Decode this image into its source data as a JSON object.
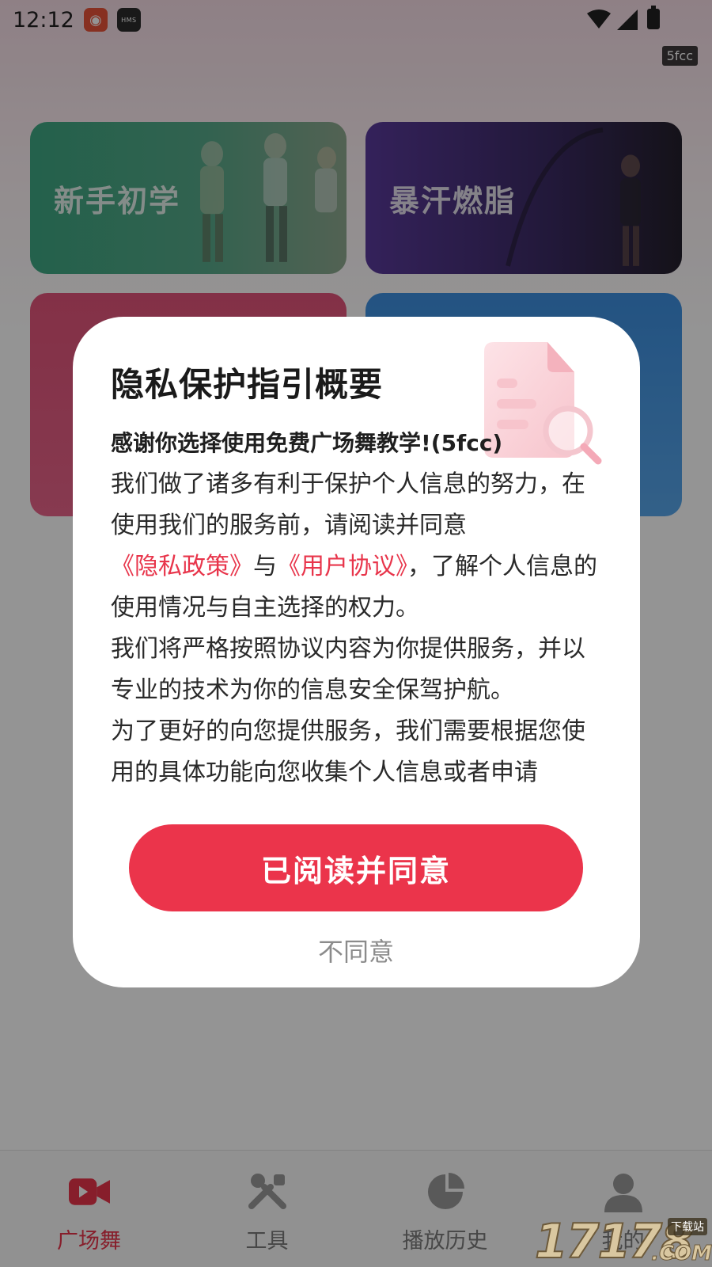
{
  "status_bar": {
    "time": "12:12",
    "app_icons": [
      "weibo-icon",
      "hms-icon"
    ],
    "hms_label": "HMS",
    "system_icons": [
      "wifi-icon",
      "signal-icon",
      "battery-icon"
    ]
  },
  "corner_tag": "5fcc",
  "category_cards": [
    {
      "label": "新手初学",
      "color": "#3ea883"
    },
    {
      "label": "暴汗燃脂",
      "color": "#5a3a9c"
    },
    {
      "label": "",
      "color": "#e2547a"
    },
    {
      "label": "",
      "color": "#3d8fe0"
    }
  ],
  "privacy_dialog": {
    "title": "隐私保护指引概要",
    "illustration": "document-search-icon",
    "lead": "感谢你选择使用免费广场舞教学!(5fcc)",
    "paragraph_1_before": "我们做了诸多有利于保护个人信息的努力，在使用我们的服务前，请阅读并同意",
    "privacy_policy_link": "《隐私政策》",
    "connector": "与",
    "user_agreement_link": "《用户协议》",
    "paragraph_1_after": "，了解个人信息的使用情况与自主选择的权力。",
    "paragraph_2": "我们将严格按照协议内容为你提供服务，并以专业的技术为你的信息安全保驾护航。",
    "paragraph_3": "为了更好的向您提供服务，我们需要根据您使用的具体功能向您收集个人信息或者申请",
    "agree_label": "已阅读并同意",
    "disagree_label": "不同意",
    "accent_color": "#eb344b"
  },
  "tab_bar": {
    "tabs": [
      {
        "label": "广场舞",
        "icon": "video-camera-icon",
        "active": true
      },
      {
        "label": "工具",
        "icon": "tools-icon",
        "active": false
      },
      {
        "label": "播放历史",
        "icon": "pie-chart-icon",
        "active": false
      },
      {
        "label": "我的",
        "icon": "user-icon",
        "active": false
      }
    ]
  },
  "watermark": {
    "number": "17178",
    "small_text": "下载站",
    "domain": ".COM"
  }
}
